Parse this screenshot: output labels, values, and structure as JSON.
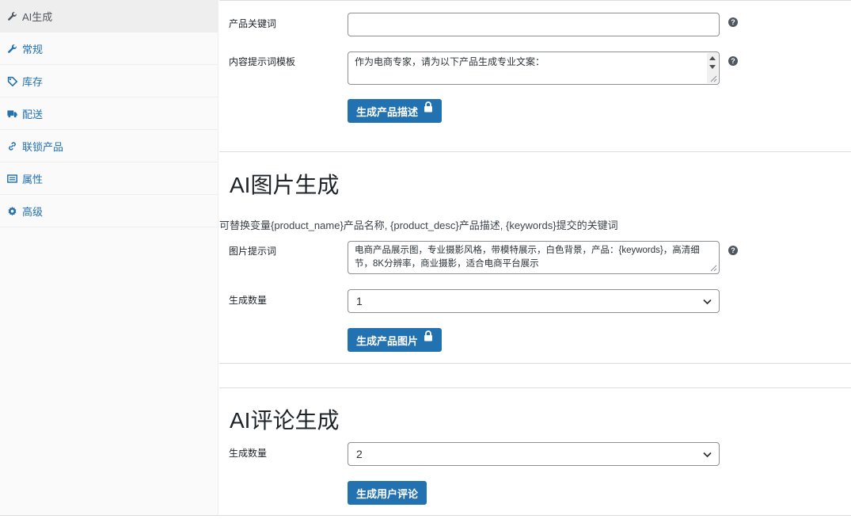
{
  "sidebar": {
    "items": [
      {
        "label": "AI生成",
        "icon": "wrench-icon"
      },
      {
        "label": "常规",
        "icon": "wrench-icon"
      },
      {
        "label": "库存",
        "icon": "tag-icon"
      },
      {
        "label": "配送",
        "icon": "truck-icon"
      },
      {
        "label": "联锁产品",
        "icon": "link-icon"
      },
      {
        "label": "属性",
        "icon": "list-icon"
      },
      {
        "label": "高级",
        "icon": "gear-icon"
      }
    ]
  },
  "text_section": {
    "keyword_label": "产品关键词",
    "keyword_value": "",
    "template_label": "内容提示词模板",
    "template_value": "作为电商专家，请为以下产品生成专业文案：",
    "generate_button": "生成产品描述"
  },
  "image_section": {
    "title": "AI图片生成",
    "description": "可替换变量{product_name}产品名称, {product_desc}产品描述, {keywords}提交的关键词",
    "prompt_label": "图片提示词",
    "prompt_value": "电商产品展示图，专业摄影风格，带模特展示，白色背景，产品：{keywords}，高清细节，8K分辨率，商业摄影，适合电商平台展示",
    "count_label": "生成数量",
    "count_value": "1",
    "generate_button": "生成产品图片"
  },
  "review_section": {
    "title": "AI评论生成",
    "count_label": "生成数量",
    "count_value": "2",
    "generate_button": "生成用户评论"
  },
  "help_glyph": "?",
  "colors": {
    "accent": "#2271b1",
    "link": "#2271b1",
    "sidebar_bg": "#fafafa",
    "active_bg": "#eeeeee"
  }
}
